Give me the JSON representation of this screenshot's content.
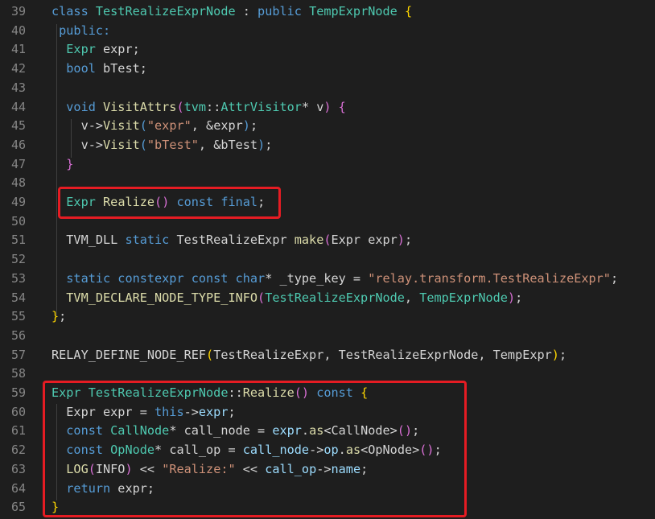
{
  "colors": {
    "background": "#1e1e1e",
    "line_number": "#858585",
    "keyword": "#569cd6",
    "type": "#4ec9b0",
    "function": "#dcdcaa",
    "string": "#ce9178",
    "variable": "#9cdcfe",
    "macro": "#dcdcaa",
    "text": "#d4d4d4",
    "bracket": "#ffd700",
    "bracket2": "#da70d6",
    "highlight_box": "#e51c23"
  },
  "editor": {
    "lines": [
      {
        "n": "39",
        "tokens": [
          [
            "class ",
            "kw"
          ],
          [
            "TestRealizeExprNode",
            "ty"
          ],
          [
            " : ",
            "tx"
          ],
          [
            "public ",
            "kw"
          ],
          [
            "TempExprNode",
            "ty"
          ],
          [
            " {",
            "br"
          ]
        ]
      },
      {
        "n": "40",
        "tokens": [
          [
            " public:",
            "kw"
          ]
        ]
      },
      {
        "n": "41",
        "tokens": [
          [
            "  Expr",
            "ty"
          ],
          [
            " expr;",
            "tx"
          ]
        ]
      },
      {
        "n": "42",
        "tokens": [
          [
            "  bool",
            "kw"
          ],
          [
            " bTest;",
            "tx"
          ]
        ]
      },
      {
        "n": "43",
        "tokens": []
      },
      {
        "n": "44",
        "tokens": [
          [
            "  void ",
            "kw"
          ],
          [
            "VisitAttrs",
            "fn"
          ],
          [
            "(",
            "b2"
          ],
          [
            "tvm",
            "ty"
          ],
          [
            "::",
            "tx"
          ],
          [
            "AttrVisitor",
            "ty"
          ],
          [
            "* v",
            "tx"
          ],
          [
            ")",
            "b2"
          ],
          [
            " {",
            "b2"
          ]
        ]
      },
      {
        "n": "45",
        "tokens": [
          [
            "    v->",
            "tx"
          ],
          [
            "Visit",
            "fn"
          ],
          [
            "(",
            "b3"
          ],
          [
            "\"expr\"",
            "st"
          ],
          [
            ", &expr",
            "tx"
          ],
          [
            ")",
            "b3"
          ],
          [
            ";",
            "tx"
          ]
        ]
      },
      {
        "n": "46",
        "tokens": [
          [
            "    v->",
            "tx"
          ],
          [
            "Visit",
            "fn"
          ],
          [
            "(",
            "b3"
          ],
          [
            "\"bTest\"",
            "st"
          ],
          [
            ", &bTest",
            "tx"
          ],
          [
            ")",
            "b3"
          ],
          [
            ";",
            "tx"
          ]
        ]
      },
      {
        "n": "47",
        "tokens": [
          [
            "  }",
            "b2"
          ]
        ]
      },
      {
        "n": "48",
        "tokens": []
      },
      {
        "n": "49",
        "tokens": [
          [
            "  Expr",
            "ty"
          ],
          [
            " ",
            "tx"
          ],
          [
            "Realize",
            "fn"
          ],
          [
            "()",
            "b2"
          ],
          [
            " const ",
            "kw"
          ],
          [
            "final",
            "kw"
          ],
          [
            ";",
            "tx"
          ]
        ]
      },
      {
        "n": "50",
        "tokens": []
      },
      {
        "n": "51",
        "tokens": [
          [
            "  TVM_DLL ",
            "tx"
          ],
          [
            "static ",
            "kw"
          ],
          [
            "TestRealizeExpr ",
            "tx"
          ],
          [
            "make",
            "fn"
          ],
          [
            "(",
            "b2"
          ],
          [
            "Expr expr",
            "tx"
          ],
          [
            ")",
            "b2"
          ],
          [
            ";",
            "tx"
          ]
        ]
      },
      {
        "n": "52",
        "tokens": []
      },
      {
        "n": "53",
        "tokens": [
          [
            "  static ",
            "kw"
          ],
          [
            "constexpr ",
            "kw"
          ],
          [
            "const ",
            "kw"
          ],
          [
            "char",
            "kw"
          ],
          [
            "* _type_key = ",
            "tx"
          ],
          [
            "\"relay.transform.TestRealizeExpr\"",
            "st"
          ],
          [
            ";",
            "tx"
          ]
        ]
      },
      {
        "n": "54",
        "tokens": [
          [
            "  TVM_DECLARE_NODE_TYPE_INFO",
            "fn"
          ],
          [
            "(",
            "b2"
          ],
          [
            "TestRealizeExprNode",
            "ty"
          ],
          [
            ", ",
            "tx"
          ],
          [
            "TempExprNode",
            "ty"
          ],
          [
            ")",
            "b2"
          ],
          [
            ";",
            "tx"
          ]
        ]
      },
      {
        "n": "55",
        "tokens": [
          [
            "}",
            "br"
          ],
          [
            ";",
            "tx"
          ]
        ]
      },
      {
        "n": "56",
        "tokens": []
      },
      {
        "n": "57",
        "tokens": [
          [
            "RELAY_DEFINE_NODE_REF",
            "tx"
          ],
          [
            "(",
            "br"
          ],
          [
            "TestRealizeExpr, TestRealizeExprNode, TempExpr",
            "tx"
          ],
          [
            ")",
            "br"
          ],
          [
            ";",
            "tx"
          ]
        ]
      },
      {
        "n": "58",
        "tokens": []
      },
      {
        "n": "59",
        "tokens": [
          [
            "Expr",
            "ty"
          ],
          [
            " ",
            "tx"
          ],
          [
            "TestRealizeExprNode",
            "ty"
          ],
          [
            "::",
            "tx"
          ],
          [
            "Realize",
            "fn"
          ],
          [
            "()",
            "b2"
          ],
          [
            " const ",
            "kw"
          ],
          [
            "{",
            "br"
          ]
        ]
      },
      {
        "n": "60",
        "tokens": [
          [
            "  Expr expr = ",
            "tx"
          ],
          [
            "this",
            "kw"
          ],
          [
            "->",
            "tx"
          ],
          [
            "expr",
            "va"
          ],
          [
            ";",
            "tx"
          ]
        ]
      },
      {
        "n": "61",
        "tokens": [
          [
            "  const ",
            "kw"
          ],
          [
            "CallNode",
            "ty"
          ],
          [
            "* call_node = ",
            "tx"
          ],
          [
            "expr",
            "va"
          ],
          [
            ".",
            "tx"
          ],
          [
            "as",
            "fn"
          ],
          [
            "<CallNode>",
            "tx"
          ],
          [
            "()",
            "b2"
          ],
          [
            ";",
            "tx"
          ]
        ]
      },
      {
        "n": "62",
        "tokens": [
          [
            "  const ",
            "kw"
          ],
          [
            "OpNode",
            "ty"
          ],
          [
            "* call_op = ",
            "tx"
          ],
          [
            "call_node",
            "va"
          ],
          [
            "->",
            "tx"
          ],
          [
            "op",
            "va"
          ],
          [
            ".",
            "tx"
          ],
          [
            "as",
            "fn"
          ],
          [
            "<OpNode>",
            "tx"
          ],
          [
            "()",
            "b2"
          ],
          [
            ";",
            "tx"
          ]
        ]
      },
      {
        "n": "63",
        "tokens": [
          [
            "  LOG",
            "fn"
          ],
          [
            "(",
            "b2"
          ],
          [
            "INFO",
            "tx"
          ],
          [
            ")",
            "b2"
          ],
          [
            " << ",
            "tx"
          ],
          [
            "\"Realize:\"",
            "st"
          ],
          [
            " << ",
            "tx"
          ],
          [
            "call_op",
            "va"
          ],
          [
            "->",
            "tx"
          ],
          [
            "name",
            "va"
          ],
          [
            ";",
            "tx"
          ]
        ]
      },
      {
        "n": "64",
        "tokens": [
          [
            "  return",
            "kw"
          ],
          [
            " expr;",
            "tx"
          ]
        ]
      },
      {
        "n": "65",
        "tokens": [
          [
            "}",
            "br"
          ]
        ]
      }
    ]
  }
}
